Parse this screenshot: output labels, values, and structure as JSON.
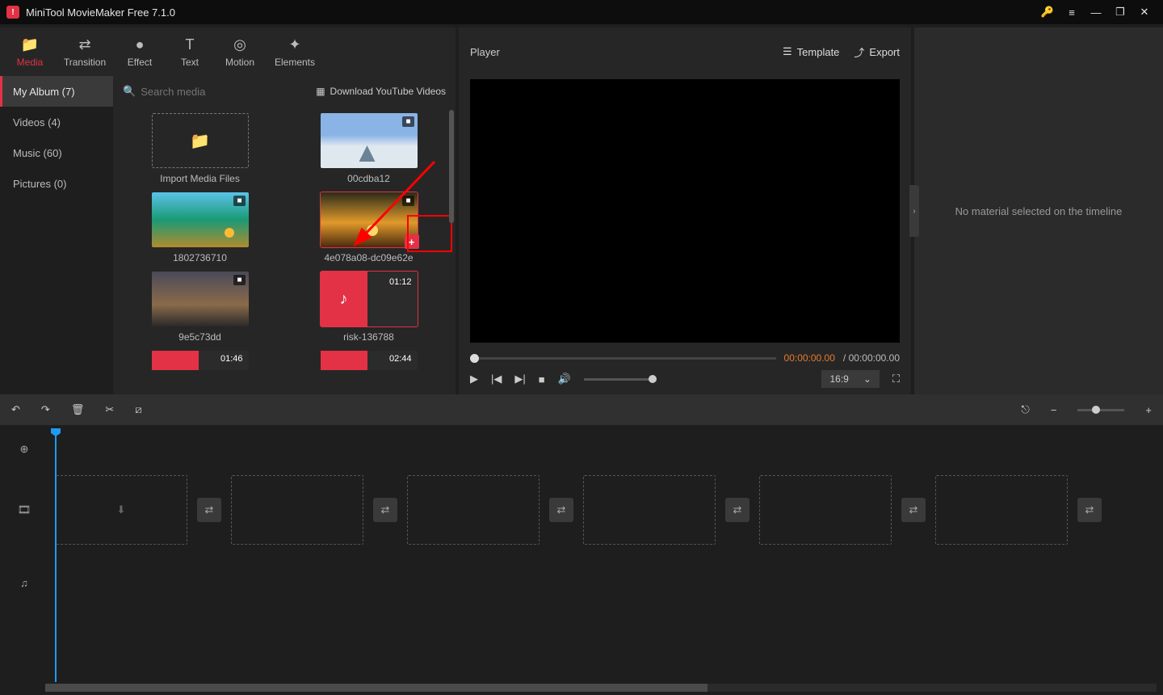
{
  "app": {
    "title": "MiniTool MovieMaker Free 7.1.0"
  },
  "tabs": {
    "media": "Media",
    "transition": "Transition",
    "effect": "Effect",
    "text": "Text",
    "motion": "Motion",
    "elements": "Elements"
  },
  "sidebar": {
    "items": [
      {
        "label": "My Album (7)"
      },
      {
        "label": "Videos (4)"
      },
      {
        "label": "Music (60)"
      },
      {
        "label": "Pictures (0)"
      }
    ]
  },
  "search": {
    "placeholder": "Search media"
  },
  "ytlink": "Download YouTube Videos",
  "media": {
    "import_label": "Import Media Files",
    "items": [
      {
        "name": "00cdba12",
        "type": "video"
      },
      {
        "name": "1802736710",
        "type": "video"
      },
      {
        "name": "4e078a08-dc09e62e",
        "type": "video",
        "selected": true,
        "add": true
      },
      {
        "name": "9e5c73dd",
        "type": "video"
      },
      {
        "name": "risk-136788",
        "type": "music",
        "dur": "01:12",
        "selected": true
      },
      {
        "name": "",
        "type": "music",
        "dur": "01:46"
      },
      {
        "name": "",
        "type": "music",
        "dur": "02:44"
      }
    ]
  },
  "player": {
    "title": "Player",
    "template_btn": "Template",
    "export_btn": "Export",
    "time_current": "00:00:00.00",
    "time_sep": " / ",
    "time_total": "00:00:00.00",
    "aspect": "16:9"
  },
  "right_panel": {
    "message": "No material selected on the timeline"
  },
  "icons": {
    "folder": "📁",
    "transition": "⇄",
    "effect": "●",
    "text": "T",
    "motion": "◎",
    "elements": "✦",
    "search": "🔍",
    "youtube": "▦",
    "video_badge": "■",
    "music_note": "♪",
    "play": "▶",
    "prev": "|◀",
    "next": "▶|",
    "stop": "■",
    "volume": "🔊",
    "fullscreen": "⛶",
    "template": "☰",
    "export": "⤴",
    "chevron_down": "⌄",
    "chevron_right": "›",
    "key": "🔑",
    "menu": "≡",
    "minimize": "—",
    "maximize": "❐",
    "close": "✕",
    "undo": "↶",
    "redo": "↷",
    "trash": "🗑",
    "cut": "✂",
    "crop": "⧄",
    "magnet": "⎋",
    "zoom_out": "−",
    "zoom_in": "+",
    "addtrack": "⊕",
    "film": "🎞",
    "audio": "♫",
    "dropzone": "⬇"
  }
}
